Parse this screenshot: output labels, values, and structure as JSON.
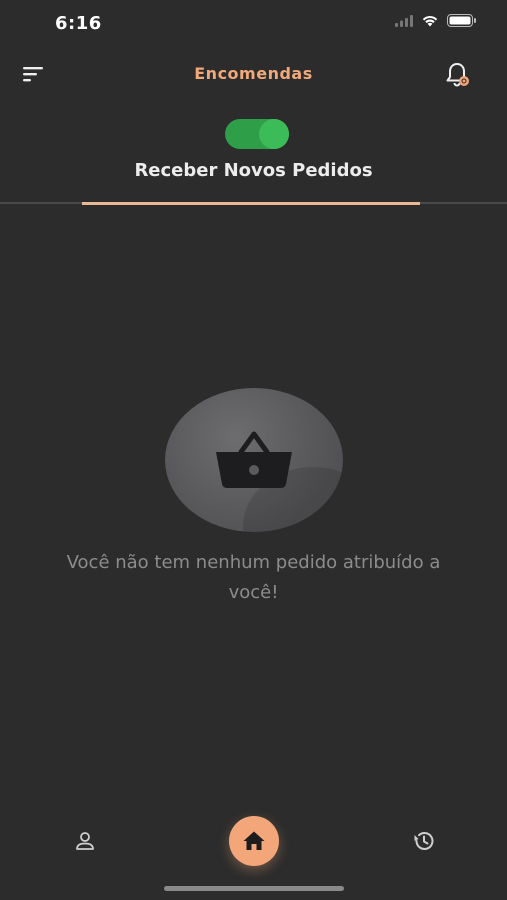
{
  "status_bar": {
    "time": "6:16"
  },
  "header": {
    "title": "Encomendas",
    "menu_icon": "filter-lines-icon",
    "notification_icon": "bell-icon"
  },
  "toggle": {
    "label": "Receber Novos Pedidos",
    "on": true,
    "color_on": "#2f9e48"
  },
  "empty_state": {
    "icon": "shopping-basket-icon",
    "message": "Você não tem nenhum pedido atribuído a você!"
  },
  "bottom_nav": {
    "items": [
      {
        "icon": "profile-icon"
      },
      {
        "icon": "home-icon",
        "active": true
      },
      {
        "icon": "history-icon"
      }
    ]
  },
  "colors": {
    "background": "#2c2c2c",
    "accent": "#f2a679",
    "title": "#f1a97a"
  }
}
